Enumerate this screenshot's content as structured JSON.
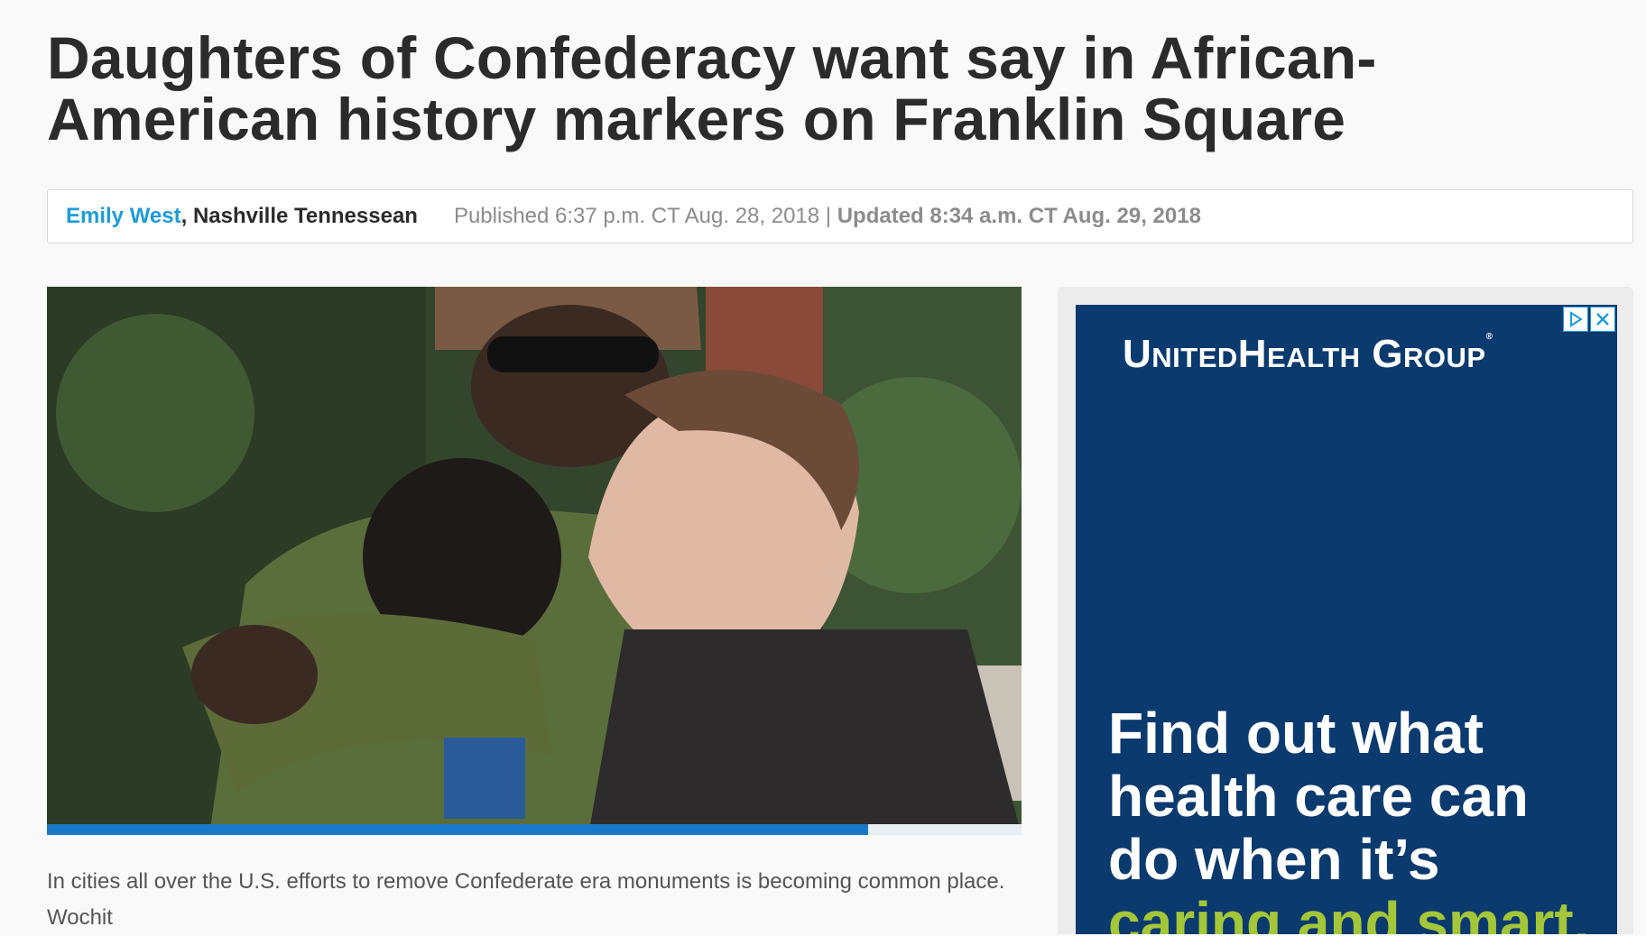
{
  "article": {
    "headline": "Daughters of Confederacy want say in African-American history markers on Franklin Square",
    "author": "Emily West",
    "organization": "Nashville Tennessean",
    "published": "Published 6:37 p.m. CT Aug. 28, 2018 |",
    "updated": "Updated 8:34 a.m. CT Aug. 29, 2018",
    "caption": "In cities all over the U.S. efforts to remove Confederate era monuments is becoming common place.",
    "credit": "Wochit"
  },
  "video": {
    "progress": 0.843,
    "progress_color": "#1a78c8"
  },
  "ad": {
    "brand": "UnitedHealth Group",
    "copy_line1": "Find out what",
    "copy_line2": "health care can",
    "copy_line3": "do when it’s",
    "copy_highlight": "caring and smart.",
    "bg_color": "#0b3a6e",
    "highlight_color": "#a4c639",
    "adchoices_icon": "adchoices-icon",
    "close_icon": "close-icon"
  },
  "colors": {
    "author_link": "#1e9bd7"
  }
}
